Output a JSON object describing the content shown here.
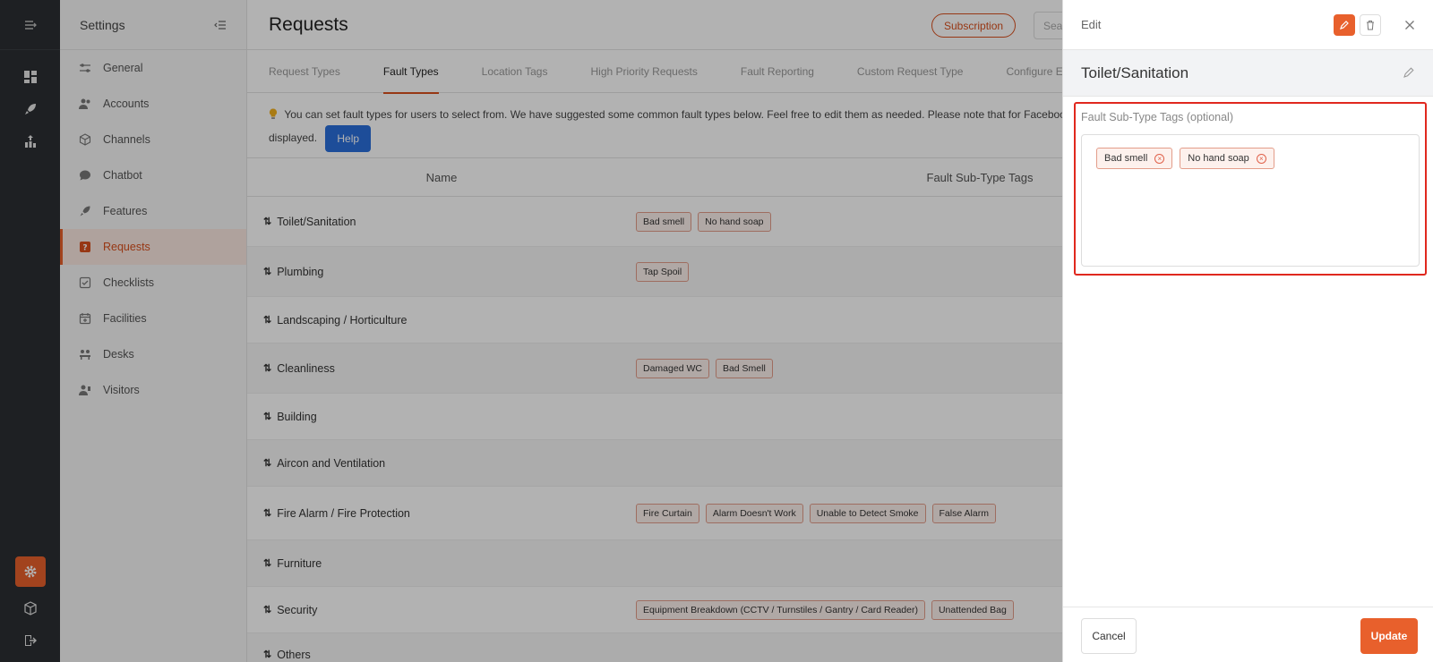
{
  "settings": {
    "title": "Settings",
    "items": [
      {
        "label": "General",
        "icon": "sliders-icon"
      },
      {
        "label": "Accounts",
        "icon": "users-icon"
      },
      {
        "label": "Channels",
        "icon": "cube-icon"
      },
      {
        "label": "Chatbot",
        "icon": "chat-bubble-icon"
      },
      {
        "label": "Features",
        "icon": "rocket-icon"
      },
      {
        "label": "Requests",
        "icon": "question-square-icon",
        "active": true
      },
      {
        "label": "Checklists",
        "icon": "checkbox-icon"
      },
      {
        "label": "Facilities",
        "icon": "calendar-plus-icon"
      },
      {
        "label": "Desks",
        "icon": "people-desk-icon"
      },
      {
        "label": "Visitors",
        "icon": "visitor-icon"
      }
    ]
  },
  "header": {
    "title": "Requests",
    "subscription_label": "Subscription",
    "search_placeholder": "Sear"
  },
  "tabs": [
    {
      "label": "Request Types"
    },
    {
      "label": "Fault Types",
      "active": true
    },
    {
      "label": "Location Tags"
    },
    {
      "label": "High Priority Requests"
    },
    {
      "label": "Fault Reporting"
    },
    {
      "label": "Custom Request Type"
    },
    {
      "label": "Configure Email"
    }
  ],
  "notice": {
    "text": "You can set fault types for users to select from. We have suggested some common fault types below. Feel free to edit them as needed. Please note that for Facebook Mes",
    "text2": "displayed.",
    "help_label": "Help"
  },
  "table": {
    "headers": {
      "name": "Name",
      "tags": "Fault Sub-Type Tags"
    },
    "rows": [
      {
        "name": "Toilet/Sanitation",
        "tags": [
          "Bad smell",
          "No hand soap"
        ]
      },
      {
        "name": "Plumbing",
        "tags": [
          "Tap Spoil"
        ]
      },
      {
        "name": "Landscaping / Horticulture",
        "tags": []
      },
      {
        "name": "Cleanliness",
        "tags": [
          "Damaged WC",
          "Bad Smell"
        ]
      },
      {
        "name": "Building",
        "tags": []
      },
      {
        "name": "Aircon and Ventilation",
        "tags": []
      },
      {
        "name": "Fire Alarm / Fire Protection",
        "tags": [
          "Fire Curtain",
          "Alarm Doesn't Work",
          "Unable to Detect Smoke",
          "False Alarm"
        ]
      },
      {
        "name": "Furniture",
        "tags": []
      },
      {
        "name": "Security",
        "tags": [
          "Equipment Breakdown (CCTV / Turnstiles / Gantry / Card Reader)",
          "Unattended Bag"
        ]
      },
      {
        "name": "Others",
        "tags": []
      }
    ]
  },
  "drawer": {
    "title": "Edit",
    "item_name": "Toilet/Sanitation",
    "field_label": "Fault Sub-Type Tags (optional)",
    "tags": [
      "Bad smell",
      "No hand soap"
    ],
    "cancel_label": "Cancel",
    "update_label": "Update"
  },
  "colors": {
    "accent": "#e8602c",
    "rail_bg": "#2b2f33",
    "help_blue": "#2a6fdb",
    "highlight_red": "#e0281e"
  }
}
